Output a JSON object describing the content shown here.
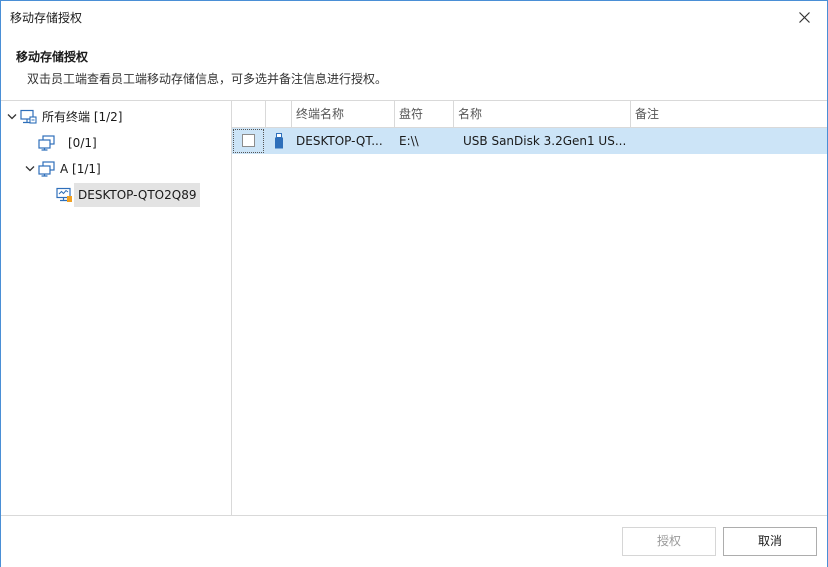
{
  "window": {
    "title": "移动存储授权",
    "close_icon": "close-icon"
  },
  "header": {
    "title": "移动存储授权",
    "description": "双击员工端查看员工端移动存储信息，可多选并备注信息进行授权。"
  },
  "tree": {
    "nodes": [
      {
        "label": "所有终端  [1/2]",
        "icon": "computer-network-icon",
        "expanded": true
      },
      {
        "label": "[0/1]",
        "icon": "computer-group-icon"
      },
      {
        "label": "A  [1/1]",
        "icon": "computer-group-icon",
        "expanded": true
      },
      {
        "label": "DESKTOP-QTO2Q89",
        "icon": "computer-online-icon",
        "selected": true
      }
    ]
  },
  "table": {
    "columns": [
      "",
      "",
      "终端名称",
      "盘符",
      "名称",
      "备注"
    ],
    "rows": [
      {
        "checked": false,
        "icon": "usb-drive-icon",
        "terminal": "DESKTOP-QT...",
        "drive": "E:\\\\",
        "name": "USB   SanDisk 3.2Gen1 US...",
        "note": ""
      }
    ]
  },
  "footer": {
    "authorize_label": "授权",
    "cancel_label": "取消"
  },
  "colors": {
    "selection": "#cce4f7",
    "tree_selected": "#e3e3e3",
    "window_border": "#4a8fd6",
    "icon_blue": "#2e6fba"
  }
}
